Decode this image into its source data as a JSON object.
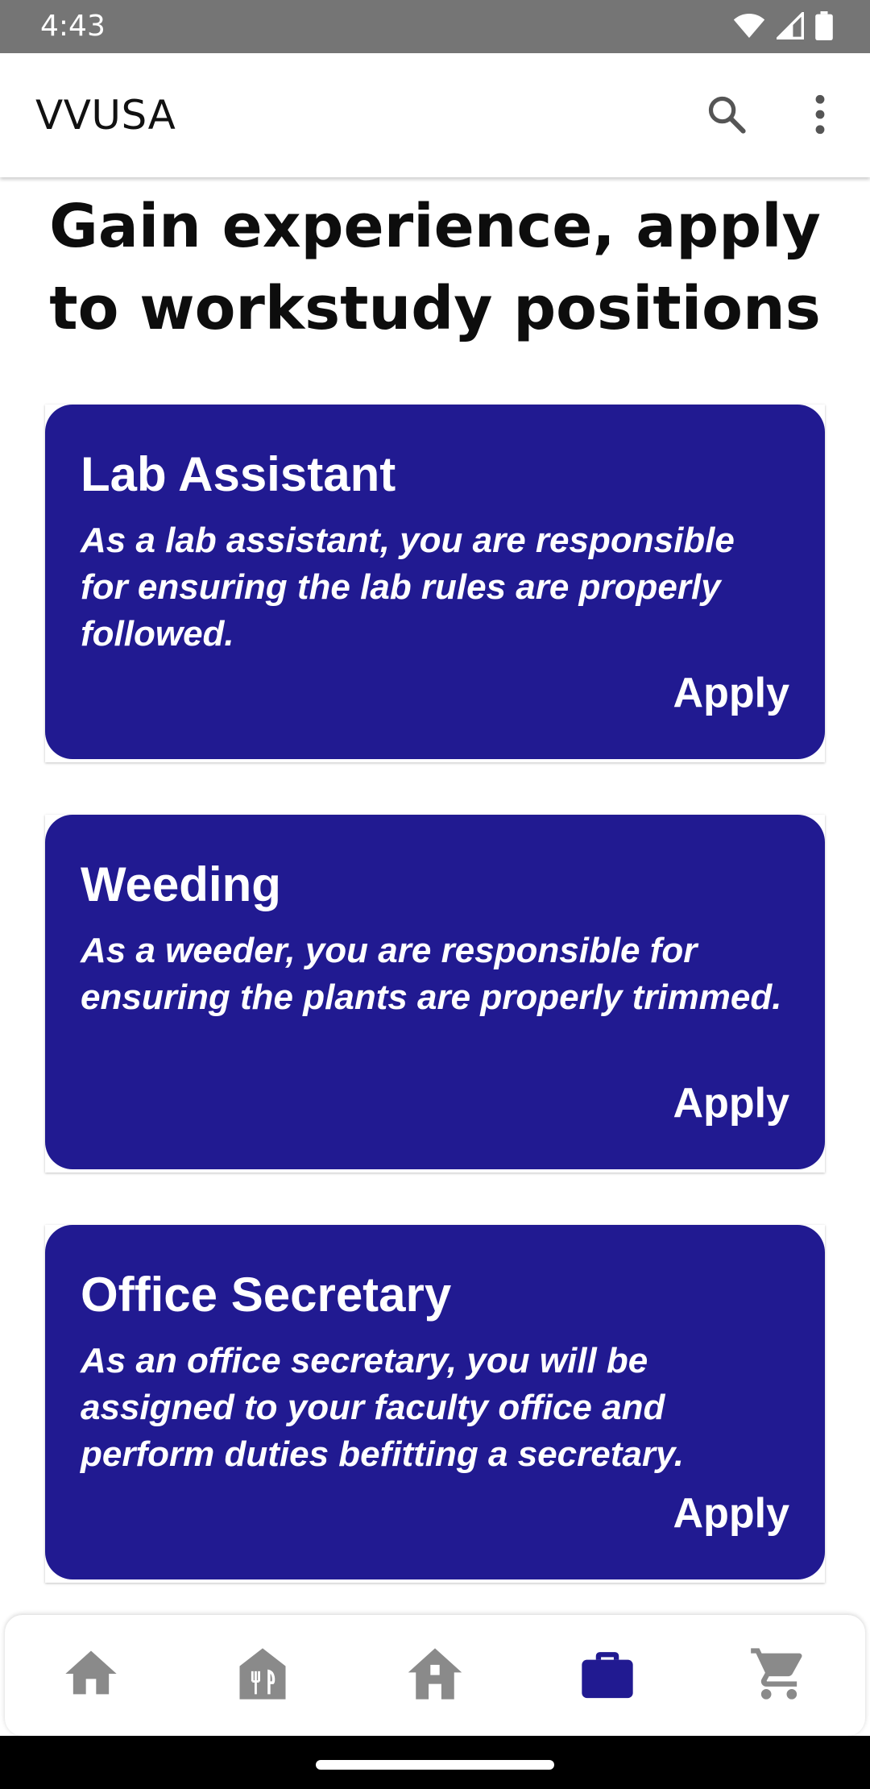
{
  "status_bar": {
    "time": "4:43",
    "icons": [
      "wifi-icon",
      "cell-signal-icon",
      "battery-icon"
    ]
  },
  "app_bar": {
    "title": "VVUSA",
    "actions": [
      "search-icon",
      "more-vert-icon"
    ]
  },
  "page": {
    "heading": "Gain experience, apply to workstudy positions"
  },
  "positions": [
    {
      "title": "Lab Assistant",
      "description": "As a lab assistant, you are responsible for ensuring the lab rules are properly followed.",
      "apply_label": "Apply"
    },
    {
      "title": "Weeding",
      "description": "As a weeder, you are responsible for ensuring the plants are properly trimmed.",
      "apply_label": "Apply"
    },
    {
      "title": "Office Secretary",
      "description": "As an office secretary, you will be assigned to your faculty office and perform duties befitting a secretary.",
      "apply_label": "Apply"
    }
  ],
  "bottom_nav": {
    "items": [
      {
        "icon": "home-icon",
        "active": false
      },
      {
        "icon": "dining-hall-icon",
        "active": false
      },
      {
        "icon": "dorm-house-icon",
        "active": false
      },
      {
        "icon": "briefcase-icon",
        "active": true
      },
      {
        "icon": "shopping-cart-icon",
        "active": false
      }
    ]
  },
  "colors": {
    "status_bar": "#757575",
    "card_background": "#211a91",
    "nav_active": "#211a91",
    "nav_inactive": "#8a8a8a"
  }
}
